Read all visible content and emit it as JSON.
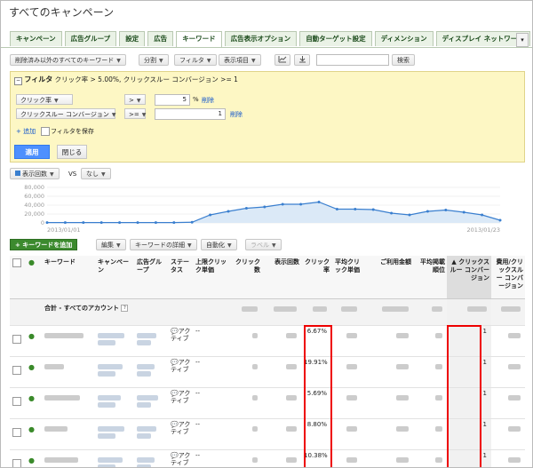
{
  "page": {
    "title": "すべてのキャンペーン"
  },
  "tabs": [
    "キャンペーン",
    "広告グループ",
    "設定",
    "広告",
    "キーワード",
    "広告表示オプション",
    "自動ターゲット設定",
    "ディメンション",
    "ディスプレイ ネットワーク"
  ],
  "tab_more": "▾",
  "toolbar": {
    "view_filter": "削除済み以外のすべてのキーワード",
    "segment": "分割",
    "filter": "フィルタ",
    "columns": "表示項目",
    "chart_icon": "chart-icon",
    "download_icon": "download-icon",
    "search_value": "",
    "search_button": "検索"
  },
  "filter_panel": {
    "heading": "フィルタ",
    "summary": "クリック率 > 5.00%, クリックスルー コンバージョン >= 1",
    "rows": [
      {
        "field": "クリック率",
        "operator": ">",
        "value": "5",
        "unit": "%",
        "delete": "削除"
      },
      {
        "field": "クリックスルー コンバージョン",
        "operator": ">=",
        "value": "1",
        "unit": "",
        "delete": "削除"
      }
    ],
    "add": "+ 追加",
    "save_label": "フィルタを保存",
    "apply": "適用",
    "close": "閉じる"
  },
  "chart_controls": {
    "metric1": "表示回数",
    "vs": "VS",
    "metric2": "なし"
  },
  "chart_data": {
    "type": "area",
    "ylim": [
      0,
      80000
    ],
    "yticks": [
      "80,000",
      "60,000",
      "40,000",
      "20,000",
      "0"
    ],
    "x_start": "2013/01/01",
    "x_end": "2013/01/23",
    "values": [
      800,
      800,
      800,
      800,
      800,
      800,
      800,
      800,
      1500,
      18000,
      26000,
      33000,
      36000,
      42000,
      42000,
      47000,
      31000,
      31000,
      30000,
      22000,
      18000,
      26000,
      29000,
      24000,
      18000,
      6000
    ],
    "color": "#3a7fcf",
    "fill": "#dbe9f7"
  },
  "table_toolbar": {
    "add_keyword": "+ キーワードを追加",
    "edit": "編集",
    "keyword_details": "キーワードの詳細",
    "automate": "自動化",
    "label": "ラベル"
  },
  "table": {
    "headers": [
      "キーワード",
      "キャンペーン",
      "広告グループ",
      "ステータス",
      "上限クリック単価",
      "クリック数",
      "表示回数",
      "クリック率",
      "平均クリック単価",
      "ご利用金額",
      "平均掲載順位",
      "クリックスルー コンバージョン",
      "費用/クリックスルー コンバージョン"
    ],
    "total_label": "合計 - すべてのアカウント",
    "rows": [
      {
        "status": "アクティブ",
        "bid": "--",
        "ctr": "6.67%",
        "conv": "1"
      },
      {
        "status": "アクティブ",
        "bid": "--",
        "ctr": "19.91%",
        "conv": "1"
      },
      {
        "status": "アクティブ",
        "bid": "--",
        "ctr": "5.69%",
        "conv": "1"
      },
      {
        "status": "アクティブ",
        "bid": "--",
        "ctr": "8.80%",
        "conv": "1"
      },
      {
        "status": "アクティブ",
        "bid": "--",
        "ctr": "10.38%",
        "conv": "1"
      }
    ]
  },
  "colors": {
    "accent": "#4d90fe",
    "tab_bg": "#eaf2e6",
    "filter_bg": "#fdf7c4",
    "highlight": "#ee0000",
    "status_green": "#3a8a2a"
  }
}
